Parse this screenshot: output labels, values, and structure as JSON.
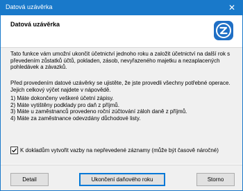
{
  "window": {
    "title": "Datová uzávěrka",
    "close_glyph": "✕"
  },
  "header": {
    "title": "Datová uzávěrka",
    "logo_icon": "app-logo-icon"
  },
  "body": {
    "intro": "Tato funkce vám umožní ukončit účetnictví jednoho roku a založit účetnictví na další rok s převedením zůstatků účtů, pokladen, zásob, nevyřazeného majetku a nezaplacených pohledávek a závazků.",
    "precheck": "Před provedením datové uzávěrky se ujistěte, že jste provedli všechny potřebné operace. Jejich celkový výčet najdete v nápovědě.",
    "steps": [
      "1) Máte dokončeny veškeré účetní zápisy.",
      "2) Máte vytištěny podklady pro daň z příjmů.",
      "3) Máte u zaměstnanců provedeno roční zúčtování záloh daně z příjmů.",
      "4) Máte za zaměstnance odevzdány důchodové listy."
    ],
    "checkbox": {
      "label": "K dokladům vytvořit vazby na nepřevedené záznamy (může být časově náročné)",
      "checked": true
    }
  },
  "footer": {
    "detail_label": "Detail",
    "run_label": "Ukončení daňového roku",
    "cancel_label": "Storno"
  },
  "colors": {
    "titlebar": "#1979ca",
    "logo": "#1f6fc5",
    "footer": "#f0f0f0"
  }
}
